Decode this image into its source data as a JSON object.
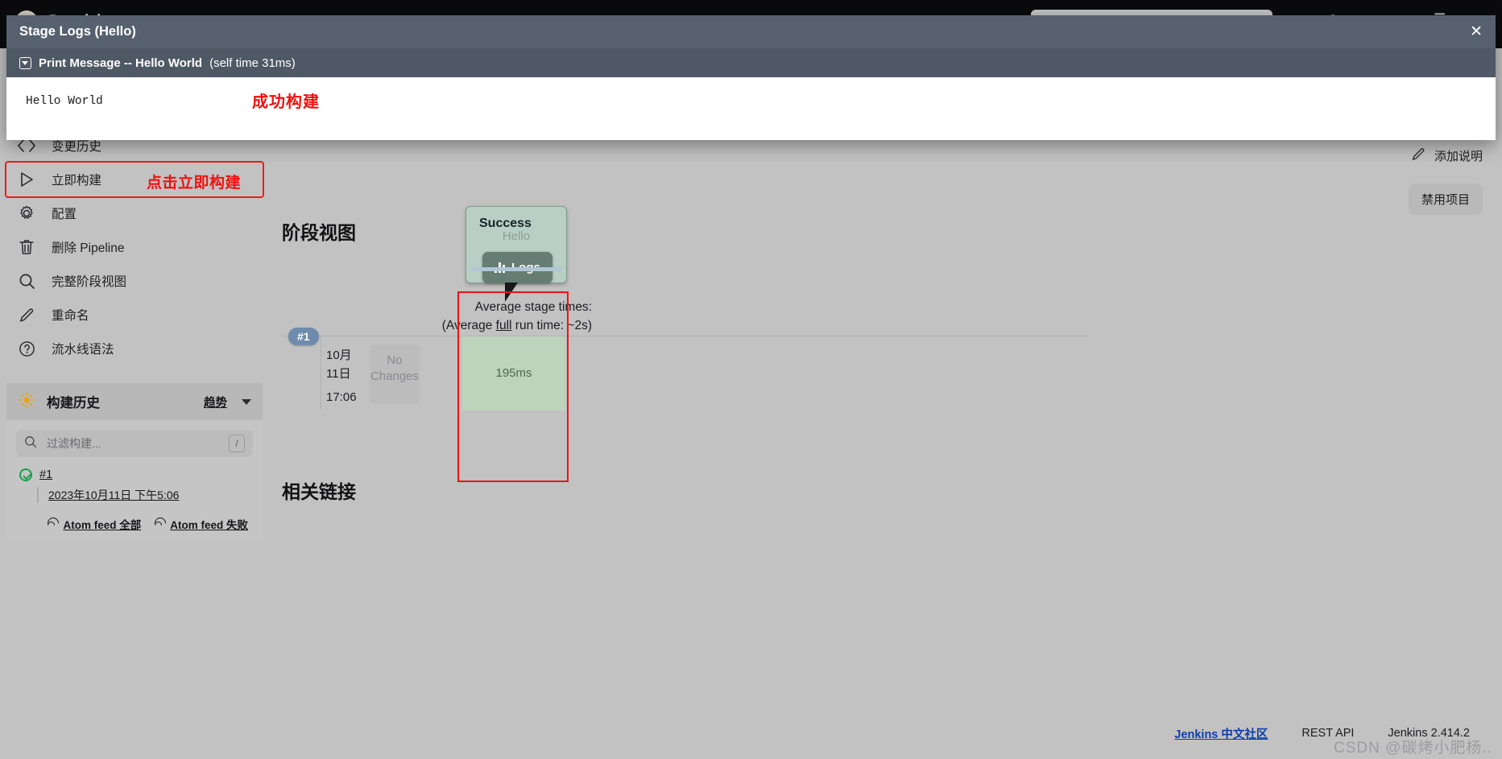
{
  "topnav": {
    "brand": "Jenkins",
    "search_placeholder": "",
    "bell_icon": "bell-icon",
    "user_icon": "user-icon"
  },
  "modal": {
    "title": "Stage Logs (Hello)",
    "close_label": "✕",
    "step_title": "Print Message -- Hello World",
    "step_meta": "(self time 31ms)",
    "log_output": "Hello World",
    "annotation": "成功构建"
  },
  "sidebar": {
    "items": [
      {
        "label": "变更历史",
        "icon": "code-icon",
        "highlight": false
      },
      {
        "label": "立即构建",
        "icon": "play-icon",
        "highlight": true
      },
      {
        "label": "配置",
        "icon": "gear-icon",
        "highlight": false
      },
      {
        "label": "删除 Pipeline",
        "icon": "trash-icon",
        "highlight": false
      },
      {
        "label": "完整阶段视图",
        "icon": "search-icon",
        "highlight": false
      },
      {
        "label": "重命名",
        "icon": "pencil-icon",
        "highlight": false
      },
      {
        "label": "流水线语法",
        "icon": "help-icon",
        "highlight": false
      }
    ],
    "annotation": "点击立即构建",
    "build_history": {
      "title": "构建历史",
      "trend_label": "趋势",
      "sun_icon": "sun-icon",
      "filter_placeholder": "过滤构建...",
      "filter_value": "",
      "filter_shortcut": "/",
      "build_number": "#1",
      "build_status_icon": "success-check-icon",
      "build_date": "2023年10月11日 下午5:06",
      "feeds": [
        {
          "label": "Atom feed 全部",
          "icon": "rss-icon"
        },
        {
          "label": "Atom feed 失败",
          "icon": "rss-icon"
        }
      ]
    }
  },
  "right_actions": {
    "add_description": "添加说明",
    "add_description_icon": "pencil-icon",
    "disable_project": "禁用项目"
  },
  "stage_view": {
    "title": "阶段视图",
    "avg_line1": "Average stage times:",
    "avg_line2_pre": "(Average ",
    "avg_line2_u": "full",
    "avg_line2_post": " run time: ~2s)",
    "run": {
      "badge": "#1",
      "date_month": "10月",
      "date_day": "11日",
      "time": "17:06",
      "changes": "No Changes"
    },
    "stage_cell_duration": "195ms",
    "tooltip": {
      "status": "Success",
      "stage_name": "Hello",
      "duration": "195ms",
      "logs_button": "Logs",
      "logs_icon": "bar-chart-icon"
    }
  },
  "related_links": {
    "title": "相关链接"
  },
  "footer": {
    "community": "Jenkins 中文社区",
    "rest_api": "REST API",
    "version": "Jenkins 2.414.2",
    "watermark": "CSDN @碳烤小肥杨.."
  },
  "colors": {
    "modal_header": "#56606e",
    "modal_subheader": "#4f5865",
    "annotation_red": "#ee1111",
    "success_green": "#bed3bb",
    "tooltip_green": "#b9cec4",
    "badge_blue": "#6e8bad",
    "link_blue": "#0b3fa8",
    "page_bg": "#c2c2c2"
  }
}
